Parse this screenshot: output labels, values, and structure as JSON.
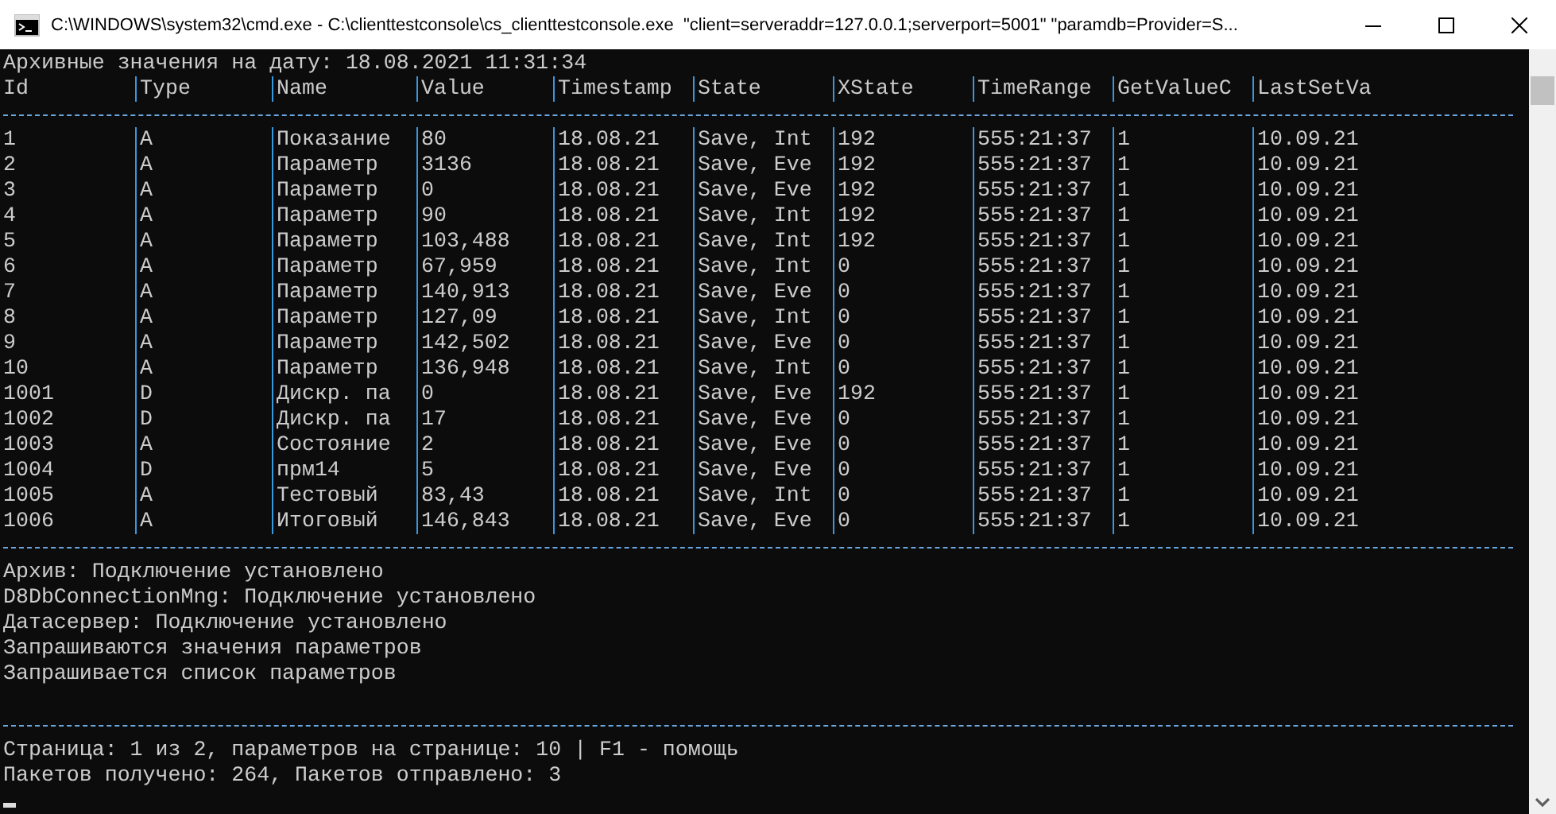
{
  "window": {
    "title": "C:\\WINDOWS\\system32\\cmd.exe - C:\\clienttestconsole\\cs_clienttestconsole.exe  \"client=serveraddr=127.0.0.1;serverport=5001\" \"paramdb=Provider=S..."
  },
  "console": {
    "heading": "Архивные значения на дату: 18.08.2021 11:31:34",
    "table": {
      "columns": [
        "Id",
        "Type",
        "Name",
        "Value",
        "Timestamp",
        "State",
        "XState",
        "TimeRange",
        "GetValueC",
        "LastSetVa"
      ],
      "rows": [
        [
          "1",
          "A",
          "Показание",
          "80",
          "18.08.21",
          "Save, Int",
          "192",
          "555:21:37",
          "1",
          "10.09.21"
        ],
        [
          "2",
          "A",
          "Параметр",
          "3136",
          "18.08.21",
          "Save, Eve",
          "192",
          "555:21:37",
          "1",
          "10.09.21"
        ],
        [
          "3",
          "A",
          "Параметр",
          "0",
          "18.08.21",
          "Save, Eve",
          "192",
          "555:21:37",
          "1",
          "10.09.21"
        ],
        [
          "4",
          "A",
          "Параметр",
          "90",
          "18.08.21",
          "Save, Int",
          "192",
          "555:21:37",
          "1",
          "10.09.21"
        ],
        [
          "5",
          "A",
          "Параметр",
          "103,488",
          "18.08.21",
          "Save, Int",
          "192",
          "555:21:37",
          "1",
          "10.09.21"
        ],
        [
          "6",
          "A",
          "Параметр",
          "67,959",
          "18.08.21",
          "Save, Int",
          "0",
          "555:21:37",
          "1",
          "10.09.21"
        ],
        [
          "7",
          "A",
          "Параметр",
          "140,913",
          "18.08.21",
          "Save, Eve",
          "0",
          "555:21:37",
          "1",
          "10.09.21"
        ],
        [
          "8",
          "A",
          "Параметр",
          "127,09",
          "18.08.21",
          "Save, Int",
          "0",
          "555:21:37",
          "1",
          "10.09.21"
        ],
        [
          "9",
          "A",
          "Параметр",
          "142,502",
          "18.08.21",
          "Save, Eve",
          "0",
          "555:21:37",
          "1",
          "10.09.21"
        ],
        [
          "10",
          "A",
          "Параметр",
          "136,948",
          "18.08.21",
          "Save, Int",
          "0",
          "555:21:37",
          "1",
          "10.09.21"
        ],
        [
          "1001",
          "D",
          "Дискр. па",
          "0",
          "18.08.21",
          "Save, Eve",
          "192",
          "555:21:37",
          "1",
          "10.09.21"
        ],
        [
          "1002",
          "D",
          "Дискр. па",
          "17",
          "18.08.21",
          "Save, Eve",
          "0",
          "555:21:37",
          "1",
          "10.09.21"
        ],
        [
          "1003",
          "A",
          "Состояние",
          "2",
          "18.08.21",
          "Save, Eve",
          "0",
          "555:21:37",
          "1",
          "10.09.21"
        ],
        [
          "1004",
          "D",
          "прм14",
          "5",
          "18.08.21",
          "Save, Eve",
          "0",
          "555:21:37",
          "1",
          "10.09.21"
        ],
        [
          "1005",
          "A",
          "Тестовый",
          "83,43",
          "18.08.21",
          "Save, Int",
          "0",
          "555:21:37",
          "1",
          "10.09.21"
        ],
        [
          "1006",
          "A",
          "Итоговый",
          "146,843",
          "18.08.21",
          "Save, Eve",
          "0",
          "555:21:37",
          "1",
          "10.09.21"
        ]
      ]
    },
    "messages": [
      "Архив: Подключение установлено",
      "D8DbConnectionMng: Подключение установлено",
      "Датасервер: Подключение установлено",
      "Запрашиваются значения параметров",
      "Запрашивается список параметров"
    ],
    "status_lines": [
      "Страница: 1 из 2, параметров на странице: 10 | F1 - помощь",
      "Пакетов получено: 264, Пакетов отправлено: 3"
    ]
  }
}
